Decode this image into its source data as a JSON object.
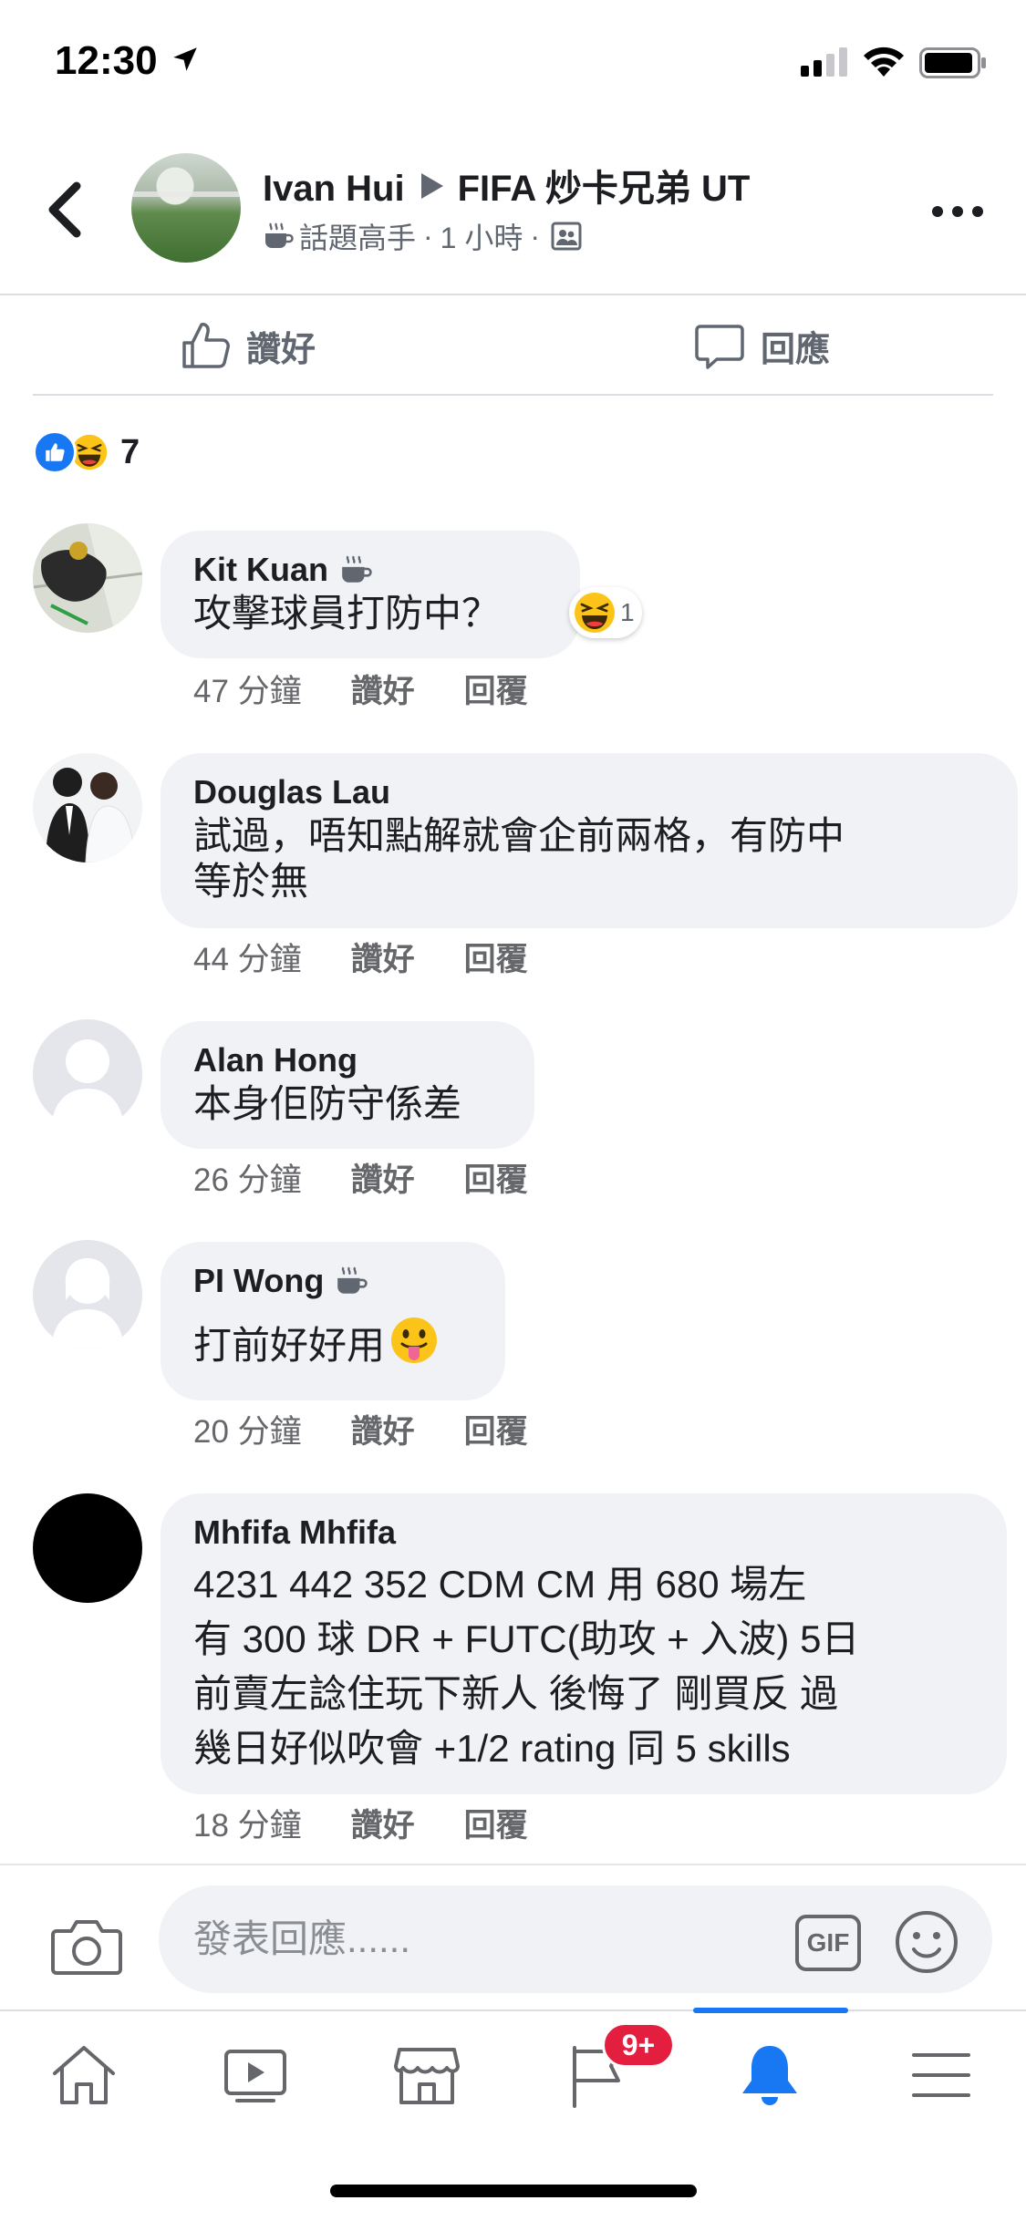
{
  "status_bar": {
    "time": "12:30"
  },
  "header": {
    "author": "Ivan Hui",
    "group": "FIFA 炒卡兄弟 UT",
    "badge": "話題高手",
    "time": "1 小時",
    "separator": "·"
  },
  "actions": {
    "like_label": "讚好",
    "reply_label": "回應"
  },
  "reactions": {
    "count": "7"
  },
  "comments": [
    {
      "name": "Kit Kuan",
      "text": "攻擊球員打防中？",
      "time": "47 分鐘",
      "like": "讚好",
      "reply": "回覆",
      "reaction_count": "1"
    },
    {
      "name": "Douglas Lau",
      "text_lines": [
        "試過，唔知點解就會企前兩格，有防中",
        "等於無"
      ],
      "time": "44 分鐘",
      "like": "讚好",
      "reply": "回覆"
    },
    {
      "name": "Alan Hong",
      "text": "本身佢防守係差",
      "time": "26 分鐘",
      "like": "讚好",
      "reply": "回覆"
    },
    {
      "name": "PI Wong",
      "text": "打前好好用",
      "time": "20 分鐘",
      "like": "讚好",
      "reply": "回覆"
    },
    {
      "name": "Mhfifa Mhfifa",
      "text_lines": [
        "4231 442 352 CDM CM 用 680 場左",
        "有 300 球 DR + FUTC(助攻 + 入波) 5日",
        "前賣左諗住玩下新人 後悔了 剛買反 過",
        "幾日好似吹會 +1/2 rating 同 5 skills"
      ],
      "time": "18 分鐘",
      "like": "讚好",
      "reply": "回覆"
    }
  ],
  "composer": {
    "placeholder": "發表回應......",
    "gif_label": "GIF"
  },
  "tabs": {
    "notifications_badge": "9+"
  },
  "colors": {
    "accent": "#1877f2",
    "bubble": "#f0f2f5",
    "badge_red": "#e41e3f"
  }
}
